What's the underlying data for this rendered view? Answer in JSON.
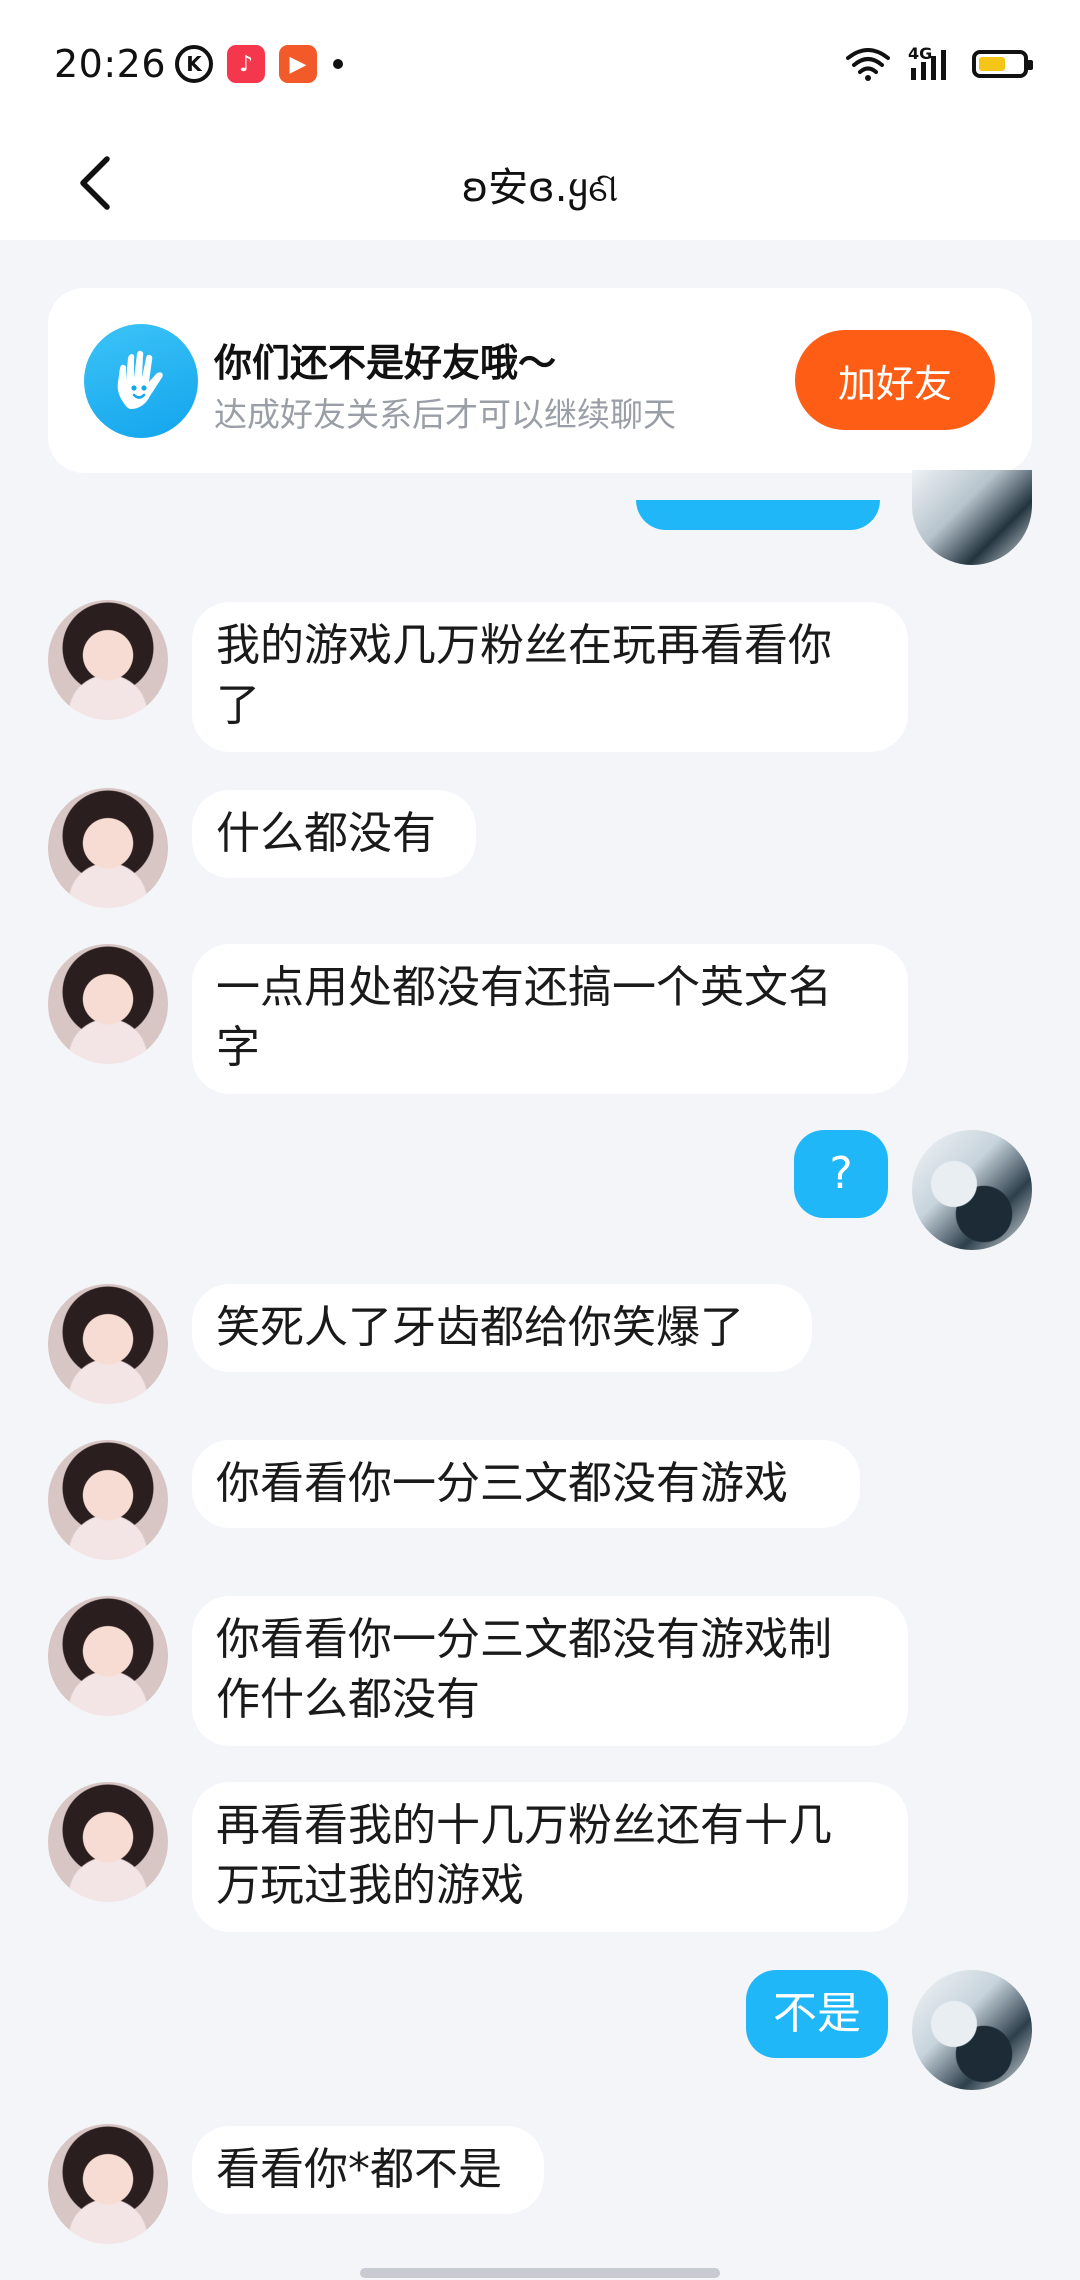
{
  "status_bar": {
    "time": "20:26",
    "app_k_label": "K",
    "app_music_label": "♪",
    "app_video_label": "▶",
    "network": "4G"
  },
  "nav": {
    "title": "ʚ安ɞ.ყଣ"
  },
  "banner": {
    "title": "你们还不是好友哦～",
    "subtitle": "达成好友关系后才可以继续聊天",
    "add_button": "加好友"
  },
  "messages": [
    {
      "from": "peer",
      "text": "我的游戏几万粉丝在玩再看看你\n了"
    },
    {
      "from": "peer",
      "text": "什么都没有"
    },
    {
      "from": "peer",
      "text": "一点用处都没有还搞一个英文名\n字"
    },
    {
      "from": "self",
      "text": "?"
    },
    {
      "from": "peer",
      "text": "笑死人了牙齿都给你笑爆了"
    },
    {
      "from": "peer",
      "text": "你看看你一分三文都没有游戏"
    },
    {
      "from": "peer",
      "text": "你看看你一分三文都没有游戏制\n作什么都没有"
    },
    {
      "from": "peer",
      "text": "再看看我的十几万粉丝还有十几\n万玩过我的游戏"
    },
    {
      "from": "self",
      "text": "不是"
    },
    {
      "from": "peer",
      "text": "看看你*都不是"
    }
  ],
  "colors": {
    "accent_blue": "#20b7f8",
    "add_button_orange": "#fd5d15",
    "page_bg": "#f3f5f8"
  }
}
